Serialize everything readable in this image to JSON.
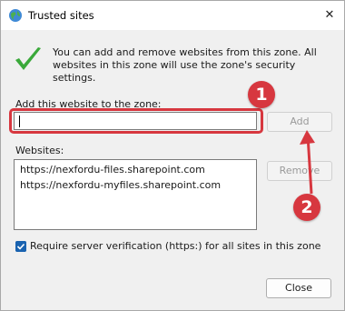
{
  "window": {
    "title": "Trusted sites",
    "close_glyph": "✕"
  },
  "intro_text": "You can add and remove websites from this zone. All websites in this zone will use the zone's security settings.",
  "add_section": {
    "label": "Add this website to the zone:",
    "input_value": "",
    "add_button": "Add"
  },
  "websites": {
    "label": "Websites:",
    "items": [
      "https://nexfordu-files.sharepoint.com",
      "https://nexfordu-myfiles.sharepoint.com"
    ],
    "remove_button": "Remove"
  },
  "verification": {
    "checked": true,
    "label": "Require server verification (https:) for all sites in this zone"
  },
  "close_button": "Close",
  "annotations": {
    "badge_1": "1",
    "badge_2": "2",
    "color": "#d7373f"
  },
  "icons": {
    "title": "globe-icon",
    "intro": "green-check-icon"
  }
}
